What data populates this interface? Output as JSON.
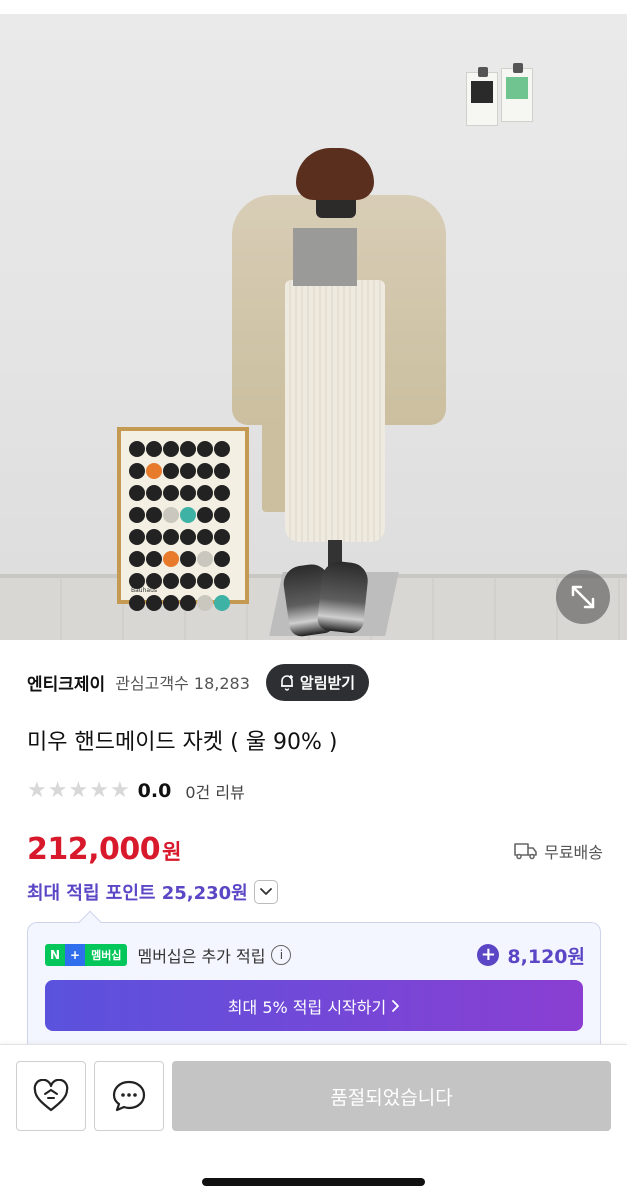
{
  "colors": {
    "price_red": "#d7192b",
    "points_purple": "#5b47c5",
    "notify_button_bg": "#2e2f33",
    "soldout_bg": "#c4c4c4",
    "naver_green": "#03c75a"
  },
  "photo": {
    "poster_caption": "Bauhaus",
    "expand_icon": "expand-arrows-icon"
  },
  "store": {
    "name": "엔티크제이",
    "fans_label": "관심고객수",
    "fans_count": "18,283",
    "notify_label": "알림받기",
    "notify_icon": "bell-plus-icon"
  },
  "product": {
    "title": "미우 핸드메이드 자켓 ( 울 90% )",
    "rating": "0.0",
    "stars_filled": 0,
    "stars_total": 5,
    "reviews": "0건 리뷰"
  },
  "price": {
    "amount": "212,000",
    "currency": "원",
    "shipping": "무료배송",
    "shipping_icon": "truck-icon"
  },
  "points": {
    "label": "최대 적립 포인트 25,230원",
    "toggle_icon": "chevron-down-icon"
  },
  "membership": {
    "badge_n": "N",
    "badge_plus": "+",
    "badge_text": "멤버십",
    "text": "멤버십은 추가 적립",
    "info": "i",
    "amount": "8,120원",
    "cta": "최대 5% 적립 시작하기"
  },
  "bottom": {
    "like_icon": "heart-icon",
    "chat_icon": "chat-bubble-icon",
    "soldout": "품절되었습니다"
  }
}
